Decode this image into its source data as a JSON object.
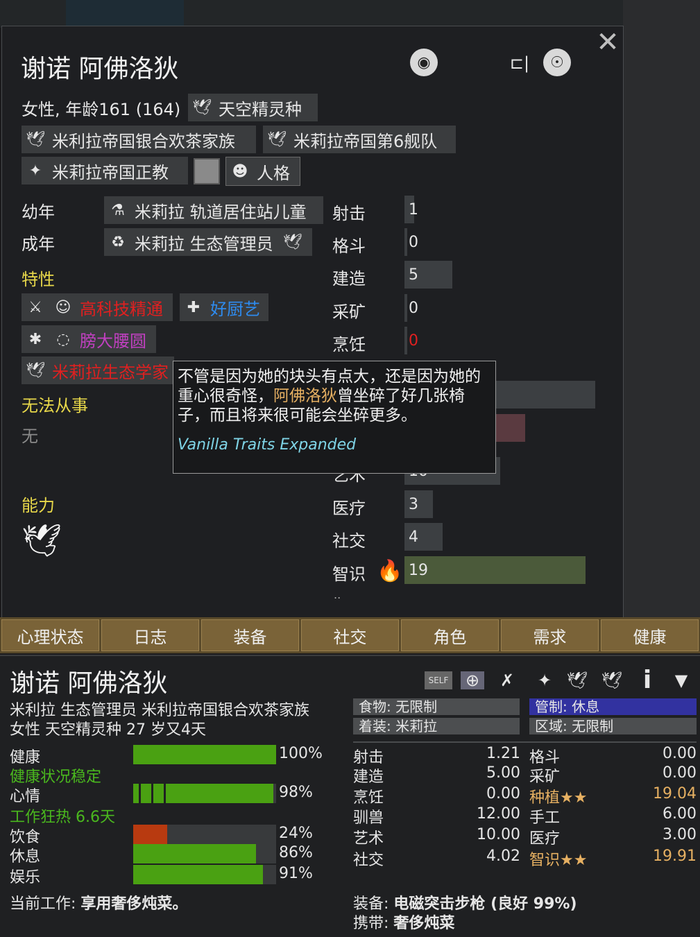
{
  "colors": {
    "yellow": "#e8d84a",
    "gold": "#e6b062",
    "green": "#4aa112",
    "red_trait": "#e02020",
    "blue_trait": "#2e8cf0",
    "magenta_trait": "#c040c0",
    "mod": "#7fd4e6"
  },
  "card": {
    "name": "谢诺 阿佛洛狄",
    "gender_age": "女性, 年龄161 (164)",
    "xenotype": "天空精灵种",
    "factions": [
      "米利拉帝国银合欢茶家族",
      "米莉拉帝国第6舰队"
    ],
    "ideo": "米莉拉帝国正教",
    "persona": "人格",
    "childhood_label": "幼年",
    "childhood": "米莉拉 轨道居住站儿童",
    "adulthood_label": "成年",
    "adulthood": "米莉拉 生态管理员",
    "traits_label": "特性",
    "traits": [
      "高科技精通",
      "好厨艺",
      "膀大腰圆",
      "米莉拉生态学家"
    ],
    "incapable_label": "无法从事",
    "incapable": "无",
    "abilities_label": "能力",
    "skills": [
      {
        "name": "射击",
        "value": "1"
      },
      {
        "name": "格斗",
        "value": "0"
      },
      {
        "name": "建造",
        "value": "5"
      },
      {
        "name": "采矿",
        "value": "0"
      },
      {
        "name": "烹饪",
        "value": "0"
      },
      {
        "name": "艺术",
        "value": "10"
      },
      {
        "name": "医疗",
        "value": "3"
      },
      {
        "name": "社交",
        "value": "4"
      },
      {
        "name": "智识",
        "value": "19"
      }
    ],
    "skill_levels": [
      1,
      0,
      5,
      0,
      0,
      10,
      3,
      4,
      19
    ],
    "skill_max": 20,
    "tooltip": {
      "text_a": "不管是因为她的块头有点大，还是因为她的重心很奇怪，",
      "highlight": "阿佛洛狄",
      "text_b": "曾坐碎了好几张椅子，而且将来很可能会坐碎更多。",
      "mod": "Vanilla Traits Expanded"
    }
  },
  "tabs": [
    "心理状态",
    "日志",
    "装备",
    "社交",
    "角色",
    "需求",
    "健康"
  ],
  "inspect": {
    "name": "谢诺 阿佛洛狄",
    "line1": "米利拉 生态管理员 米利拉帝国银合欢茶家族",
    "line2": "女性 天空精灵种 27 岁又4天",
    "food": "食物: 无限制",
    "apparel": "着装: 米莉拉",
    "control": "管制: 休息",
    "area": "区域: 无限制",
    "needs": [
      {
        "label": "健康",
        "pct": "100%",
        "level": 1.0
      },
      {
        "label": "心情",
        "pct": "98%",
        "level": 0.98
      },
      {
        "label": "饮食",
        "pct": "24%",
        "level": 0.24
      },
      {
        "label": "休息",
        "pct": "86%",
        "level": 0.86
      },
      {
        "label": "娱乐",
        "pct": "91%",
        "level": 0.91
      }
    ],
    "health_status": "健康状况稳定",
    "mood_status": "工作狂热 6.6天",
    "stats_left": [
      {
        "name": "射击",
        "value": "1.21"
      },
      {
        "name": "建造",
        "value": "5.00"
      },
      {
        "name": "烹饪",
        "value": "0.00"
      },
      {
        "name": "驯兽",
        "value": "12.00"
      },
      {
        "name": "艺术",
        "value": "10.00"
      },
      {
        "name": "社交",
        "value": "4.02"
      }
    ],
    "stats_right": [
      {
        "name": "格斗",
        "value": "0.00"
      },
      {
        "name": "采矿",
        "value": "0.00"
      },
      {
        "name": "种植★★",
        "value": "19.04"
      },
      {
        "name": "手工",
        "value": "6.00"
      },
      {
        "name": "医疗",
        "value": "3.00"
      },
      {
        "name": "智识★★",
        "value": "19.91"
      }
    ],
    "job_label": "当前工作: ",
    "job": "享用奢侈炖菜。",
    "equip_label": "装备: ",
    "equip": "电磁突击步枪 (良好 99%)",
    "carry_label": "携带: ",
    "carry": "奢侈炖菜"
  }
}
